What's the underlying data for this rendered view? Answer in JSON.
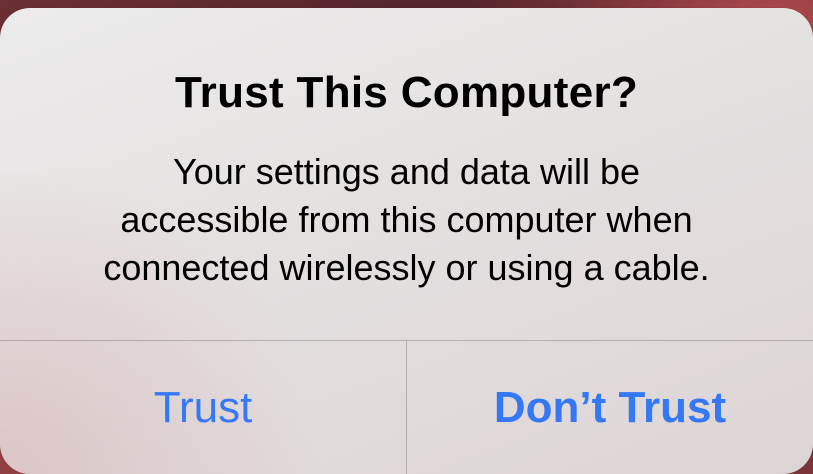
{
  "alert": {
    "title": "Trust This Computer?",
    "message_lines": [
      "Your settings and data will be",
      "accessible from this computer when",
      "connected wirelessly or using a cable."
    ],
    "buttons": {
      "trust": "Trust",
      "dont_trust": "Don’t Trust"
    }
  },
  "colors": {
    "button_text": "#3478f6",
    "title_text": "#000000",
    "divider": "rgba(60,60,67,0.28)"
  }
}
